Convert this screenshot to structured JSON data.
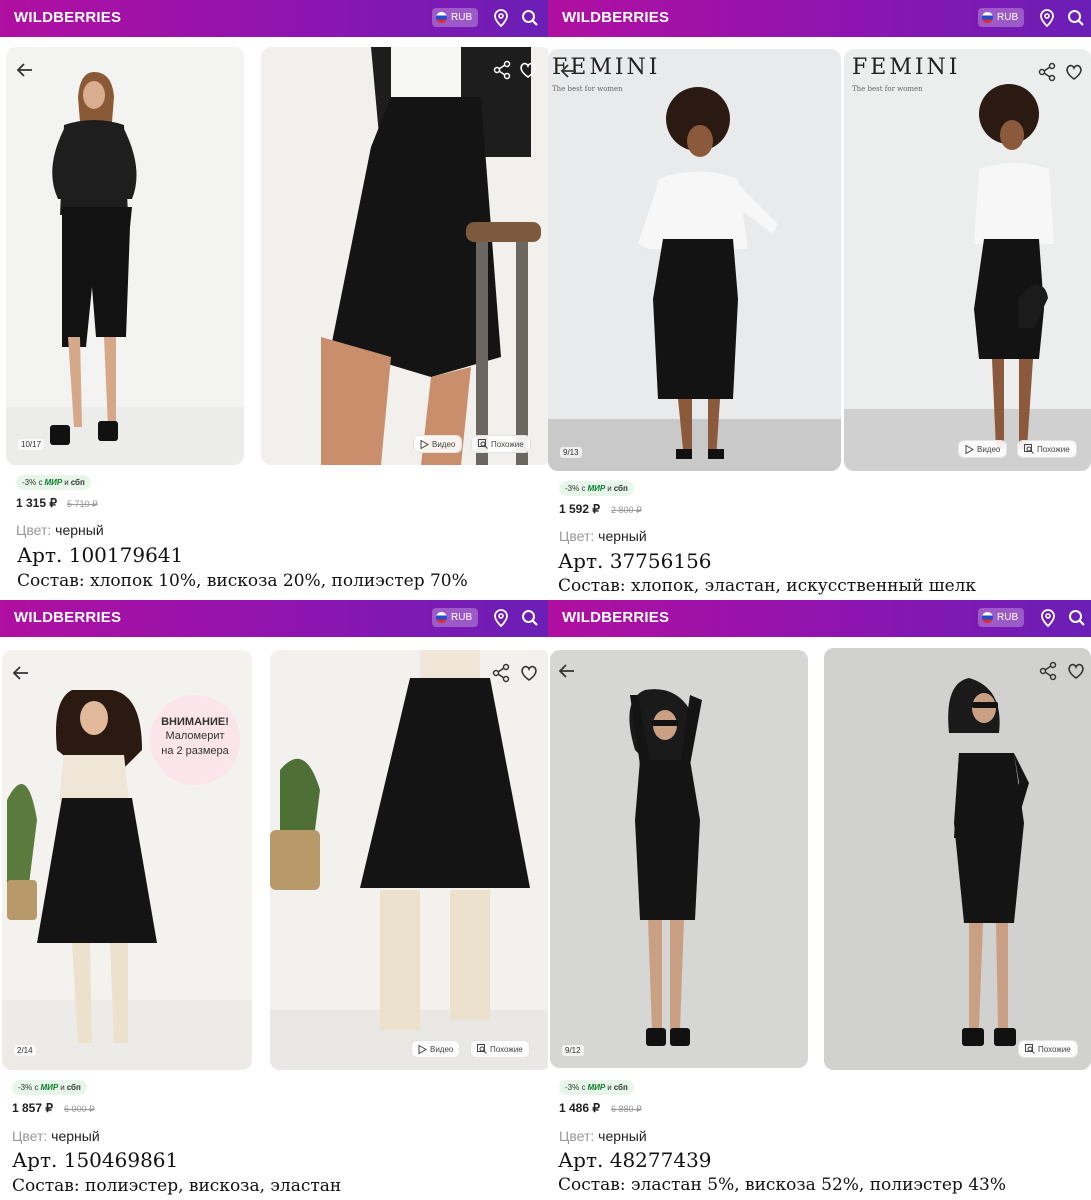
{
  "header": {
    "logo": "WILDBERRIES",
    "currency": "RUB"
  },
  "products": [
    {
      "counter": "10/17",
      "video_label": "Видео",
      "similar_label": "Похожие",
      "promo_prefix": "-3% с",
      "promo_mir": "МИР",
      "promo_and": "и",
      "promo_sbp": "сбп",
      "price": "1 315 ₽",
      "old_price": "5 710 ₽",
      "color_label": "Цвет:",
      "color_value": "черный",
      "article": "Арт. 100179641",
      "composition": "Состав: хлопок 10%, вискоза 20%, полиэстер 70%"
    },
    {
      "counter": "9/13",
      "video_label": "Видео",
      "similar_label": "Похожие",
      "brand": "FEMINI",
      "brand_sub": "The best for women",
      "promo_prefix": "-3% с",
      "promo_mir": "МИР",
      "promo_and": "и",
      "promo_sbp": "сбп",
      "price": "1 592 ₽",
      "old_price": "2 800 ₽",
      "color_label": "Цвет:",
      "color_value": "черный",
      "article": "Арт. 37756156",
      "composition": "Состав: хлопок, эластан, искусственный шелк"
    },
    {
      "counter": "2/14",
      "video_label": "Видео",
      "similar_label": "Похожие",
      "badge_title": "ВНИМАНИЕ!",
      "badge_line1": "Маломерит",
      "badge_line2": "на 2 размера",
      "promo_prefix": "-3% с",
      "promo_mir": "МИР",
      "promo_and": "и",
      "promo_sbp": "сбп",
      "price": "1 857 ₽",
      "old_price": "6 000 ₽",
      "color_label": "Цвет:",
      "color_value": "черный",
      "article": "Арт. 150469861",
      "composition": "Состав: полиэстер, вискоза, эластан"
    },
    {
      "counter": "9/12",
      "similar_label": "Похожие",
      "promo_prefix": "-3% с",
      "promo_mir": "МИР",
      "promo_and": "и",
      "promo_sbp": "сбп",
      "price": "1 486 ₽",
      "old_price": "6 880 ₽",
      "color_label": "Цвет:",
      "color_value": "черный",
      "article": "Арт. 48277439",
      "composition": "Состав: эластан 5%, вискоза 52%, полиэстер 43%"
    }
  ],
  "icons": [
    "back-arrow-icon",
    "share-icon",
    "heart-icon",
    "location-pin-icon",
    "search-icon",
    "play-icon",
    "similar-search-icon"
  ],
  "colors": {
    "header_gradient_start": "#b00fa0",
    "header_gradient_end": "#6a1fb6",
    "promo_bg": "#e8f6ea",
    "mir_green": "#0b7d2b"
  }
}
